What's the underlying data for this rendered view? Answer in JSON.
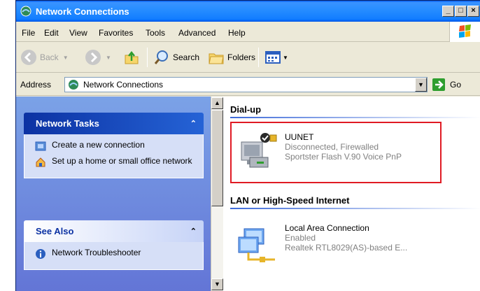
{
  "window": {
    "title": "Network Connections"
  },
  "menu": [
    "File",
    "Edit",
    "View",
    "Favorites",
    "Tools",
    "Advanced",
    "Help"
  ],
  "toolbar": {
    "back": "Back",
    "search": "Search",
    "folders": "Folders"
  },
  "address": {
    "label": "Address",
    "value": "Network Connections",
    "go": "Go"
  },
  "tasks": {
    "title": "Network Tasks",
    "items": [
      "Create a new connection",
      "Set up a home or small office network"
    ]
  },
  "see_also": {
    "title": "See Also",
    "items": [
      "Network Troubleshooter"
    ]
  },
  "groups": [
    {
      "title": "Dial-up",
      "connections": [
        {
          "name": "UUNET",
          "status": "Disconnected, Firewalled",
          "device": "Sportster Flash V.90 Voice PnP"
        }
      ]
    },
    {
      "title": "LAN or High-Speed Internet",
      "connections": [
        {
          "name": "Local Area Connection",
          "status": "Enabled",
          "device": "Realtek RTL8029(AS)-based E..."
        }
      ]
    }
  ],
  "colors": {
    "titlebar": "#0a5fe8",
    "highlight": "#e01b24",
    "taskpane": "#6f82d4"
  }
}
